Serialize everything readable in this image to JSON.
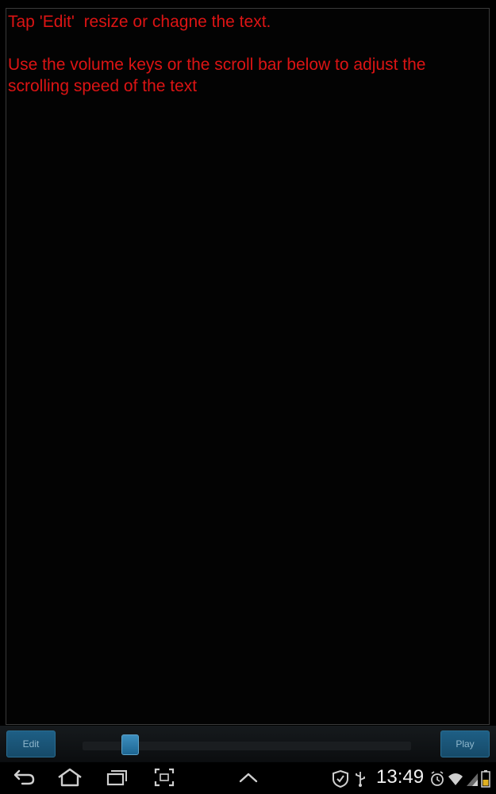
{
  "main": {
    "text": "Tap 'Edit'  resize or chagne the text.\n\nUse the volume keys or the scroll bar below to adjust the scrolling speed of the text"
  },
  "controls": {
    "edit_label": "Edit",
    "play_label": "Play",
    "speed_slider_fraction": 0.1
  },
  "status_bar": {
    "time": "13:49",
    "icons": [
      "back-icon",
      "home-icon",
      "recent-apps-icon",
      "screenshot-icon",
      "up-chevron-icon",
      "security-shield-icon",
      "usb-icon",
      "alarm-icon",
      "wifi-icon",
      "signal-icon",
      "battery-icon"
    ]
  },
  "colors": {
    "text": "#dc1414",
    "button": "#1a5a80"
  }
}
